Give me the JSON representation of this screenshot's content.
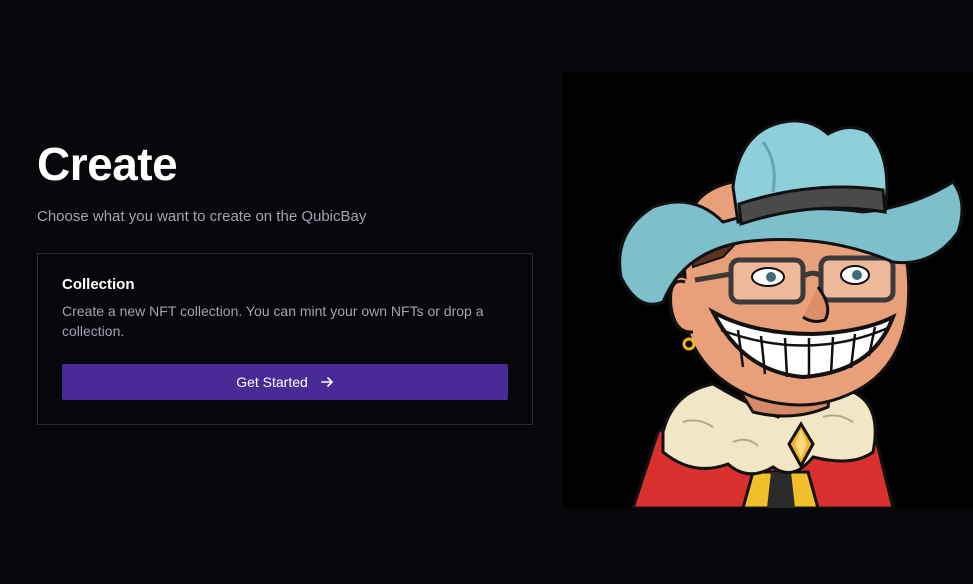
{
  "page": {
    "title": "Create",
    "subtitle": "Choose what you want to create on the QubicBay"
  },
  "card": {
    "title": "Collection",
    "description": "Create a new NFT collection. You can mint your own NFTs or drop a collection.",
    "button_label": "Get Started",
    "button_icon": "arrow-right-icon"
  },
  "illustration": {
    "subject": "cartoon-cowboy-character",
    "colors": {
      "hat": "#7dc0cb",
      "hat_band": "#4a4a4a",
      "skin": "#e9a07a",
      "coat": "#d9302e",
      "fur": "#f1e6c6",
      "gem": "#f2b32a"
    }
  },
  "theme": {
    "background": "#07060b",
    "accent": "#4a2a97",
    "text_muted": "#a6a1b4",
    "card_border": "#2b2935"
  }
}
